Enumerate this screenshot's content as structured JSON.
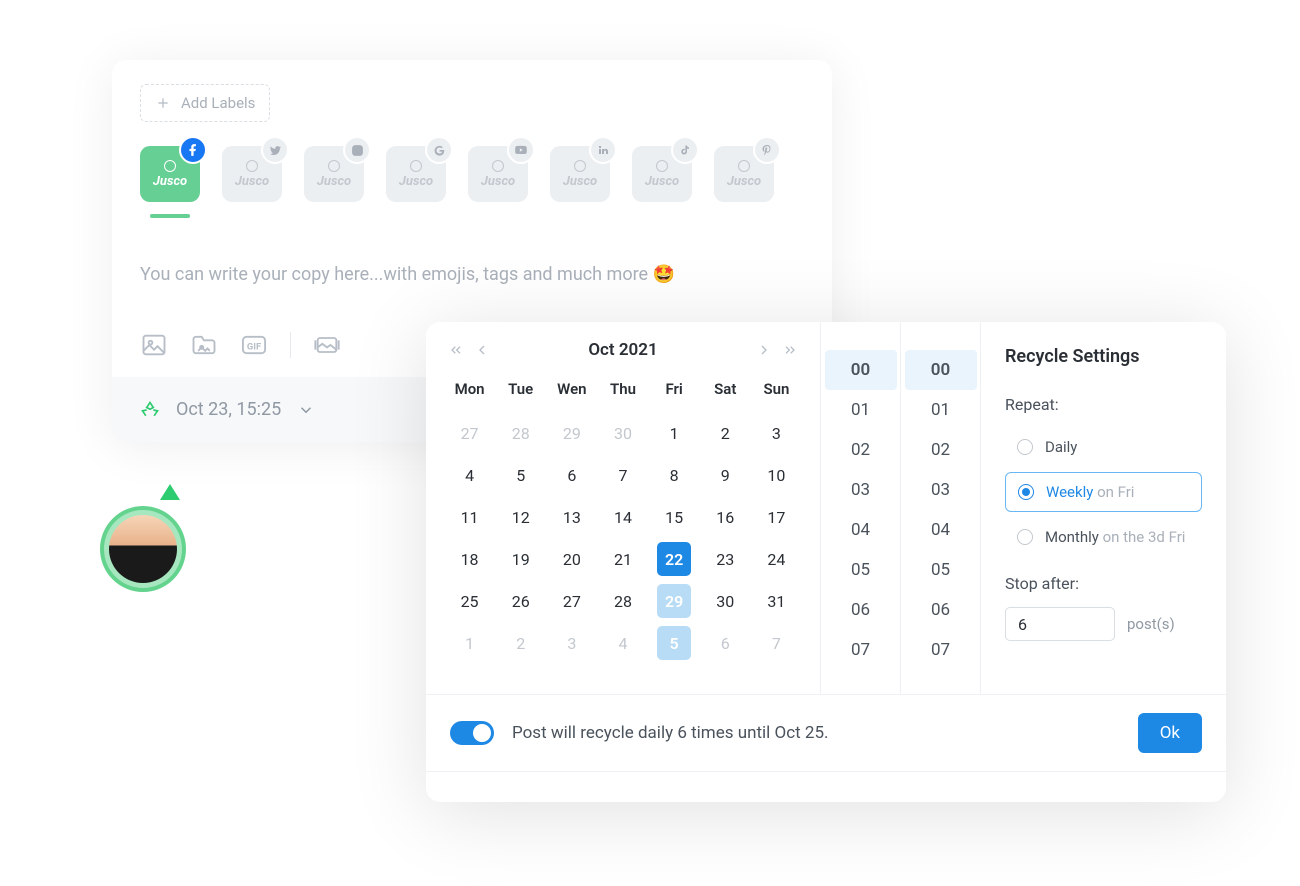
{
  "composer": {
    "add_labels": "Add Labels",
    "copy_placeholder": "You can write your copy here...with emojis, tags and much more 🤩",
    "schedule_label": "Oct 23, 15:25",
    "channels": [
      {
        "brand": "Jusco",
        "network": "facebook",
        "active": true
      },
      {
        "brand": "Jusco",
        "network": "twitter",
        "active": false
      },
      {
        "brand": "Jusco",
        "network": "instagram",
        "active": false
      },
      {
        "brand": "Jusco",
        "network": "google",
        "active": false
      },
      {
        "brand": "Jusco",
        "network": "youtube",
        "active": false
      },
      {
        "brand": "Jusco",
        "network": "linkedin",
        "active": false
      },
      {
        "brand": "Jusco",
        "network": "tiktok",
        "active": false
      },
      {
        "brand": "Jusco",
        "network": "pinterest",
        "active": false
      }
    ]
  },
  "calendar": {
    "month_label": "Oct   2021",
    "dow": [
      "Mon",
      "Tue",
      "Wen",
      "Thu",
      "Fri",
      "Sat",
      "Sun"
    ],
    "days": [
      {
        "d": "27",
        "muted": true
      },
      {
        "d": "28",
        "muted": true
      },
      {
        "d": "29",
        "muted": true
      },
      {
        "d": "30",
        "muted": true
      },
      {
        "d": "1"
      },
      {
        "d": "2"
      },
      {
        "d": "3"
      },
      {
        "d": "4"
      },
      {
        "d": "5"
      },
      {
        "d": "6"
      },
      {
        "d": "7"
      },
      {
        "d": "8"
      },
      {
        "d": "9"
      },
      {
        "d": "10"
      },
      {
        "d": "11"
      },
      {
        "d": "12"
      },
      {
        "d": "13"
      },
      {
        "d": "14"
      },
      {
        "d": "15"
      },
      {
        "d": "16"
      },
      {
        "d": "17"
      },
      {
        "d": "18"
      },
      {
        "d": "19"
      },
      {
        "d": "20"
      },
      {
        "d": "21"
      },
      {
        "d": "22",
        "sel": true
      },
      {
        "d": "23"
      },
      {
        "d": "24"
      },
      {
        "d": "25"
      },
      {
        "d": "26"
      },
      {
        "d": "27"
      },
      {
        "d": "28"
      },
      {
        "d": "29",
        "hl": true
      },
      {
        "d": "30"
      },
      {
        "d": "31"
      },
      {
        "d": "1",
        "muted": true
      },
      {
        "d": "2",
        "muted": true
      },
      {
        "d": "3",
        "muted": true
      },
      {
        "d": "4",
        "muted": true
      },
      {
        "d": "5",
        "hl": true
      },
      {
        "d": "6",
        "muted": true
      },
      {
        "d": "7",
        "muted": true
      }
    ],
    "hours": [
      "00",
      "01",
      "02",
      "03",
      "04",
      "05",
      "06",
      "07"
    ],
    "minutes": [
      "00",
      "01",
      "02",
      "03",
      "04",
      "05",
      "06",
      "07"
    ],
    "hour_selected": "00",
    "minute_selected": "00"
  },
  "recycle": {
    "title": "Recycle Settings",
    "repeat_label": "Repeat:",
    "options": [
      {
        "label": "Daily",
        "suffix": ""
      },
      {
        "label": "Weekly",
        "suffix": "on Fri",
        "selected": true
      },
      {
        "label": "Monthly",
        "suffix": "on the 3d Fri"
      }
    ],
    "stop_label": "Stop after:",
    "stop_value": "6",
    "stop_suffix": "post(s)",
    "footer_text": "Post will recycle daily 6 times until Oct 25.",
    "ok": "Ok"
  }
}
